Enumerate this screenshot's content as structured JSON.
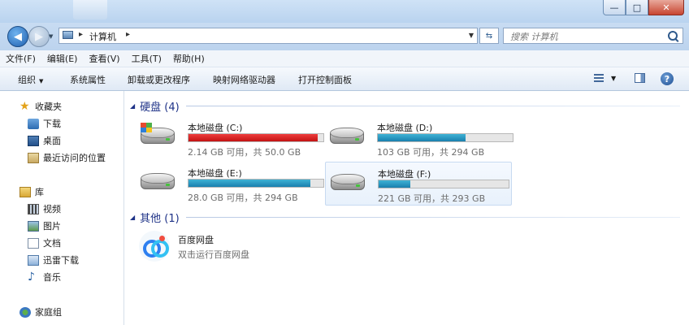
{
  "window": {
    "minimize_label": "—",
    "maximize_label": "□",
    "close_label": "✕"
  },
  "address": {
    "path_label": "计算机",
    "sep": "▸",
    "search_placeholder": "搜索 计算机"
  },
  "menu": [
    "文件(F)",
    "编辑(E)",
    "查看(V)",
    "工具(T)",
    "帮助(H)"
  ],
  "toolbar": {
    "organize": "组织",
    "system_properties": "系统属性",
    "uninstall": "卸载或更改程序",
    "map_drive": "映射网络驱动器",
    "control_panel": "打开控制面板",
    "help": "?"
  },
  "sidebar": {
    "favorites": "收藏夹",
    "downloads": "下载",
    "desktop": "桌面",
    "recent": "最近访问的位置",
    "libraries": "库",
    "videos": "视频",
    "pictures": "图片",
    "documents": "文档",
    "thunder": "迅雷下载",
    "music": "音乐",
    "homegroup": "家庭组"
  },
  "groups": {
    "hard_disks": "硬盘 (4)",
    "other": "其他 (1)"
  },
  "drives": [
    {
      "name": "本地磁盘 (C:)",
      "free": "2.14 GB 可用，共 50.0 GB",
      "used_fraction": 0.957,
      "bar_color": "#d01a1a"
    },
    {
      "name": "本地磁盘 (D:)",
      "free": "103 GB 可用，共 294 GB",
      "used_fraction": 0.65,
      "bar_color": "#2694c2"
    },
    {
      "name": "本地磁盘 (E:)",
      "free": "28.0 GB 可用，共 294 GB",
      "used_fraction": 0.905,
      "bar_color": "#2694c2"
    },
    {
      "name": "本地磁盘 (F:)",
      "free": "221 GB 可用，共 293 GB",
      "used_fraction": 0.246,
      "bar_color": "#2694c2"
    }
  ],
  "app": {
    "name": "百度网盘",
    "description": "双击运行百度网盘"
  }
}
